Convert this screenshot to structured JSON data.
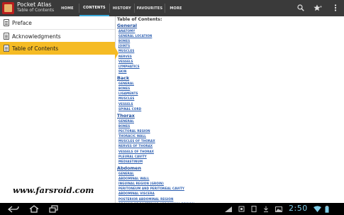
{
  "app": {
    "title": "Pocket Atlas",
    "subtitle": "Table of Contents"
  },
  "tabs": [
    {
      "label": "HOME",
      "selected": false
    },
    {
      "label": "CONTENTS",
      "selected": true
    },
    {
      "label": "HISTORY",
      "selected": false
    },
    {
      "label": "FAVOURITES",
      "selected": false
    },
    {
      "label": "MORE",
      "selected": false
    }
  ],
  "left_menu": [
    {
      "label": "Preface",
      "selected": false
    },
    {
      "label": "Acknowledgments",
      "selected": false
    },
    {
      "label": "Table of Contents",
      "selected": true
    }
  ],
  "toc": {
    "heading": "Table of Contents:",
    "sections": [
      {
        "title": "General",
        "items": [
          "ANATOMY",
          "GENERAL LOCATION",
          "BONES",
          "JOINTS",
          "MUSCLES",
          "NERVES",
          "VESSELS",
          "LYMPHATICS",
          "SKIN"
        ]
      },
      {
        "title": "Back",
        "items": [
          "GENERAL",
          "BONES",
          "LIGAMENTS",
          "MUSCLES",
          "VESSELS",
          "SPINAL CORD"
        ]
      },
      {
        "title": "Thorax",
        "items": [
          "GENERAL",
          "BONES",
          "PECTORAL REGION",
          "THORACIC WALL",
          "MUSCLES OF THORAX",
          "NERVES OF THORAX",
          "VESSELS OF THORAX",
          "PLEURAL CAVITY",
          "MEDIASTINUM"
        ]
      },
      {
        "title": "Abdomen",
        "items": [
          "GENERAL",
          "ABDOMINAL WALL",
          "INGUINAL REGION (GROIN)",
          "PERITONEUM AND PERITONEAL CAVITY",
          "ABDOMINAL VISCERA",
          "POSTERIOR ABDOMINAL REGION",
          "ORGANS OF POSTERIOR ABDOMINAL REGION"
        ]
      }
    ]
  },
  "watermark": "www.farsroid.com",
  "status": {
    "time": "2:50"
  },
  "colors": {
    "action_bar": "#3a3a3a",
    "tab_indicator": "#3aa8d8",
    "selected_item": "#f5bb24",
    "link": "#2a5db0",
    "clock": "#7fcde8"
  },
  "icons": {
    "app": "pocket-atlas-logo-icon",
    "search": "search-icon",
    "favourite": "star-icon",
    "overflow": "overflow-menu-icon",
    "back": "back-icon",
    "home": "home-icon",
    "recents": "recent-apps-icon"
  }
}
